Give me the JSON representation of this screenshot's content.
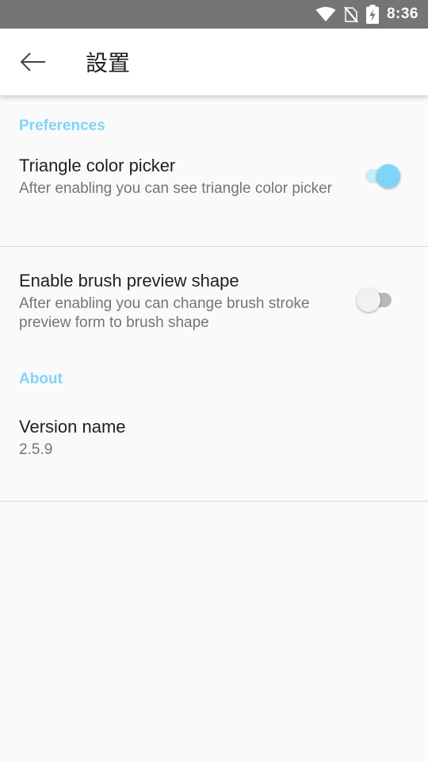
{
  "status_bar": {
    "time": "8:36",
    "icons": [
      "wifi-icon",
      "no-sim-icon",
      "battery-charging-icon"
    ]
  },
  "app_bar": {
    "back_icon": "arrow-left-icon",
    "title": "設置"
  },
  "sections": {
    "preferences": {
      "header": "Preferences",
      "items": [
        {
          "title": "Triangle color picker",
          "summary": "After enabling you can see triangle color picker",
          "enabled": true
        },
        {
          "title": "Enable brush preview shape",
          "summary": "After enabling you can change brush stroke preview form to brush shape",
          "enabled": false
        }
      ]
    },
    "about": {
      "header": "About",
      "items": [
        {
          "title": "Version name",
          "summary": "2.5.9"
        }
      ]
    }
  },
  "colors": {
    "accent": "#80d4f8",
    "status_bar": "#757575",
    "background": "#fafafa"
  }
}
